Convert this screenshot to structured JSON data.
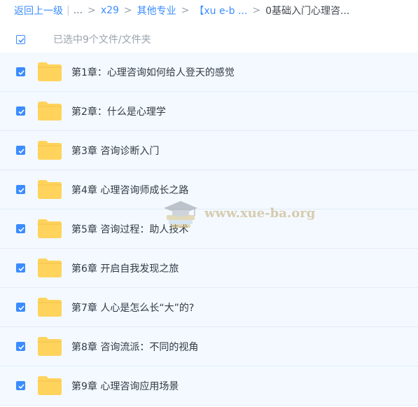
{
  "breadcrumb": {
    "back": "返回上一级",
    "ellipsis": "...",
    "crumbs": [
      "x29",
      "其他专业",
      "【xu e-b ..."
    ],
    "current": "0基础入门心理咨..."
  },
  "selection": {
    "label": "已选中9个文件/文件夹"
  },
  "files": [
    {
      "name": "第1章：心理咨询如何给人登天的感觉"
    },
    {
      "name": "第2章：什么是心理学"
    },
    {
      "name": "第3章 咨询诊断入门"
    },
    {
      "name": "第4章 心理咨询师成长之路"
    },
    {
      "name": "第5章 咨询过程：助人技术"
    },
    {
      "name": "第6章 开启自我发现之旅"
    },
    {
      "name": "第7章 人心是怎么长“大”的?"
    },
    {
      "name": "第8章 咨询流派：不同的视角"
    },
    {
      "name": "第9章 心理咨询应用场景"
    }
  ],
  "watermark": {
    "text": "www.xue-ba.org"
  },
  "colors": {
    "accent": "#3b8cff",
    "folder": "#ffd35c",
    "row_bg": "#f3f9ff"
  }
}
